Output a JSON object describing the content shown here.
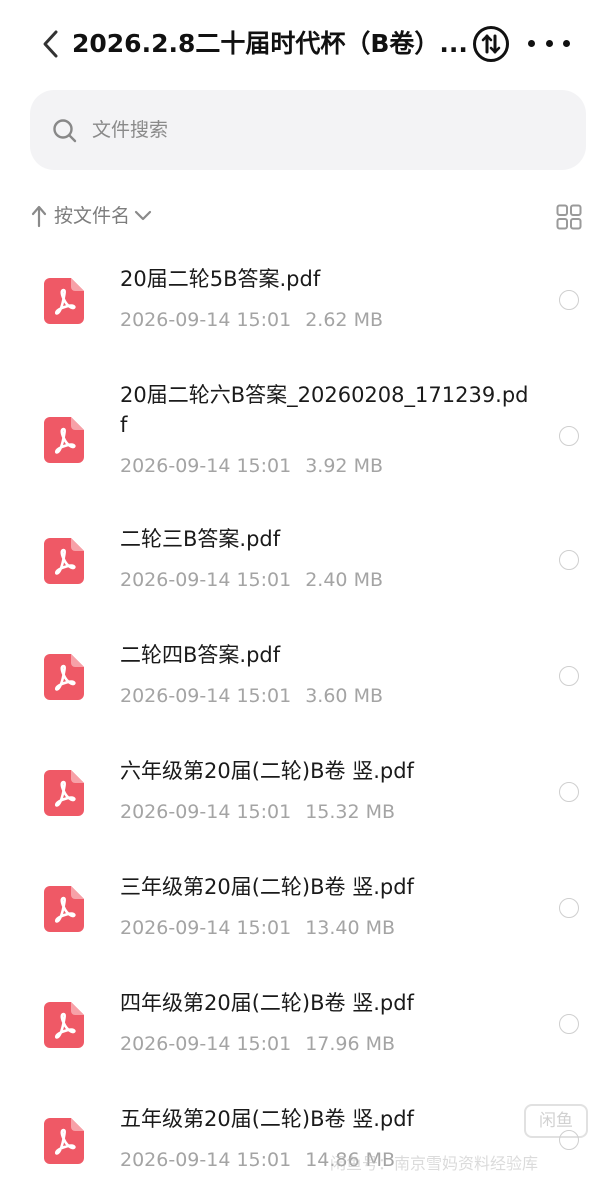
{
  "header": {
    "title": "2026.2.8二十届时代杯（B卷）...",
    "back_icon": "chevron-left-icon",
    "sort_icon": "sort-circle-icon",
    "more_icon": "more-horizontal-icon"
  },
  "search": {
    "placeholder": "文件搜索",
    "icon": "search-icon"
  },
  "sort": {
    "label": "按文件名",
    "icon": "arrow-up-icon",
    "dropdown_icon": "chevron-down-icon",
    "view_toggle_icon": "grid-view-icon"
  },
  "files": [
    {
      "name": "20届二轮5B答案.pdf",
      "date": "2026-09-14 15:01",
      "size": "2.62 MB"
    },
    {
      "name": "20届二轮六B答案_20260208_171239.pdf",
      "date": "2026-09-14 15:01",
      "size": "3.92 MB"
    },
    {
      "name": "二轮三B答案.pdf",
      "date": "2026-09-14 15:01",
      "size": "2.40 MB"
    },
    {
      "name": "二轮四B答案.pdf",
      "date": "2026-09-14 15:01",
      "size": "3.60 MB"
    },
    {
      "name": "六年级第20届(二轮)B卷 竖.pdf",
      "date": "2026-09-14 15:01",
      "size": "15.32 MB"
    },
    {
      "name": "三年级第20届(二轮)B卷 竖.pdf",
      "date": "2026-09-14 15:01",
      "size": "13.40 MB"
    },
    {
      "name": "四年级第20届(二轮)B卷 竖.pdf",
      "date": "2026-09-14 15:01",
      "size": "17.96 MB"
    },
    {
      "name": "五年级第20届(二轮)B卷 竖.pdf",
      "date": "2026-09-14 15:01",
      "size": "14.86 MB"
    }
  ],
  "colors": {
    "pdf_icon": "#ef5966",
    "pdf_icon_fold": "#f7a1a8",
    "text_primary": "#1a1a1a",
    "text_secondary": "#a4a4a4",
    "search_bg": "#f3f3f5"
  },
  "watermark": {
    "text": "闲鱼号：南京雪妈资料经验库",
    "badge": "闲鱼"
  }
}
